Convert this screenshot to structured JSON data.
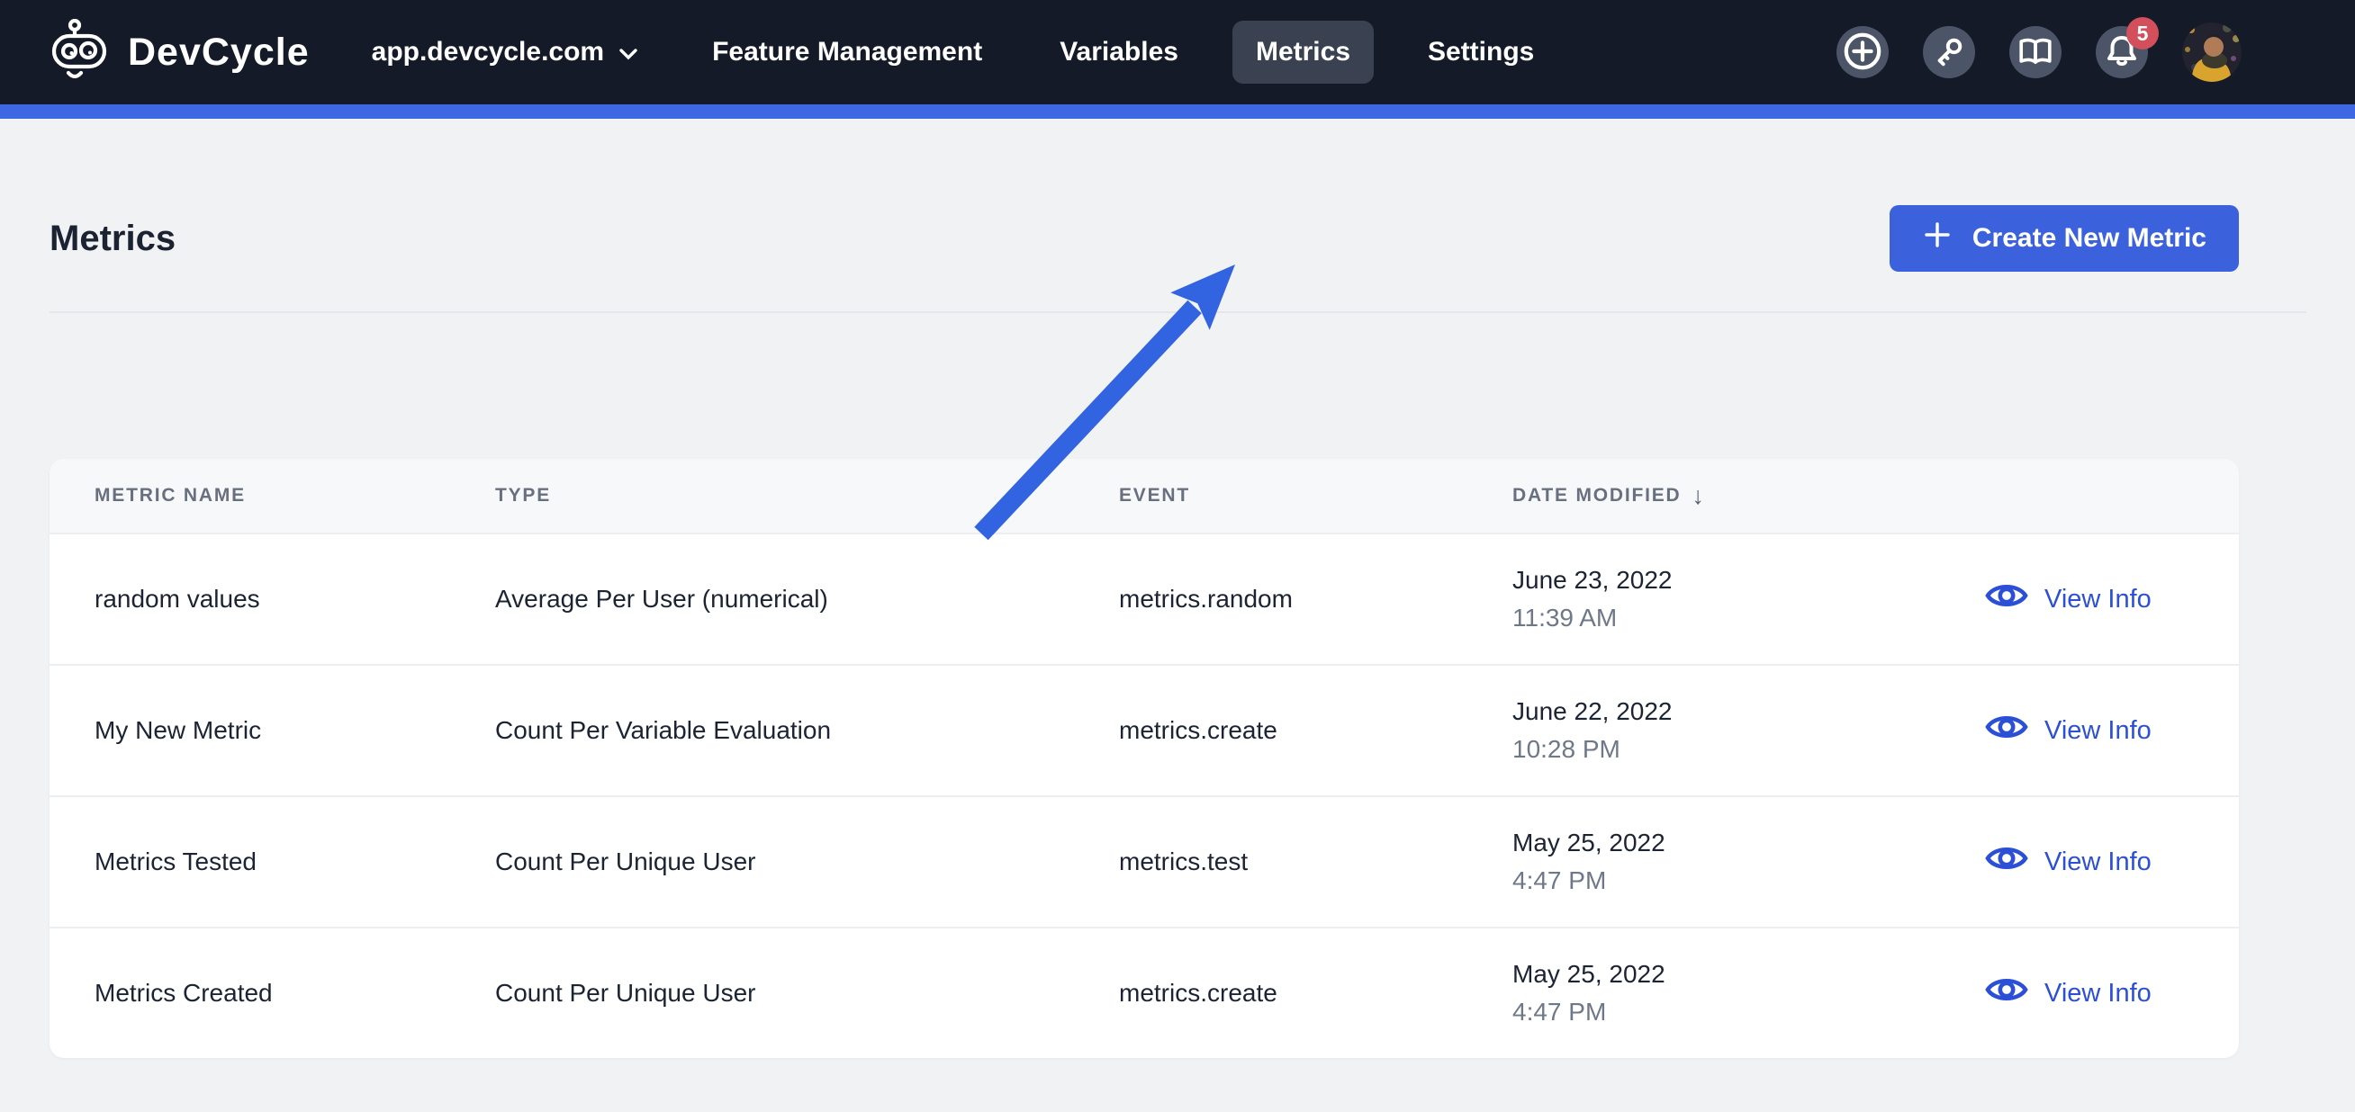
{
  "navbar": {
    "brand": "DevCycle",
    "org_selector": "app.devcycle.com",
    "items": [
      {
        "label": "Feature Management",
        "active": false
      },
      {
        "label": "Variables",
        "active": false
      },
      {
        "label": "Metrics",
        "active": true
      },
      {
        "label": "Settings",
        "active": false
      }
    ],
    "notification_count": "5",
    "icons": [
      "plus-circle",
      "key",
      "book",
      "bell",
      "avatar"
    ]
  },
  "page": {
    "title": "Metrics",
    "create_button_label": "Create New Metric"
  },
  "annotation": {
    "arrow_icon": "diagonal-arrow-up-right",
    "color": "#3263e0"
  },
  "table": {
    "columns": [
      {
        "label": "METRIC NAME"
      },
      {
        "label": "TYPE"
      },
      {
        "label": "EVENT"
      },
      {
        "label": "DATE MODIFIED",
        "sort_icon_glyph": "↓",
        "sorted": "desc"
      }
    ],
    "rows": [
      {
        "name": "random values",
        "type": "Average Per User (numerical)",
        "event": "metrics.random",
        "date": "June 23, 2022",
        "time": "11:39 AM",
        "action": "View Info"
      },
      {
        "name": "My New Metric",
        "type": "Count Per Variable Evaluation",
        "event": "metrics.create",
        "date": "June 22, 2022",
        "time": "10:28 PM",
        "action": "View Info"
      },
      {
        "name": "Metrics Tested",
        "type": "Count Per Unique User",
        "event": "metrics.test",
        "date": "May 25, 2022",
        "time": "4:47 PM",
        "action": "View Info"
      },
      {
        "name": "Metrics Created",
        "type": "Count Per Unique User",
        "event": "metrics.create",
        "date": "May 25, 2022",
        "time": "4:47 PM",
        "action": "View Info"
      }
    ]
  },
  "colors": {
    "navbar_bg": "#151a28",
    "accent_bar": "#3d68e2",
    "primary_button": "#3b61dd",
    "link_blue": "#2b4fd6",
    "annotation_arrow": "#3263e0",
    "notification_badge": "#d34f5b",
    "page_bg": "#f1f2f4",
    "card_bg": "#ffffff",
    "heading_text": "#1b2232",
    "muted_text": "#687080"
  }
}
